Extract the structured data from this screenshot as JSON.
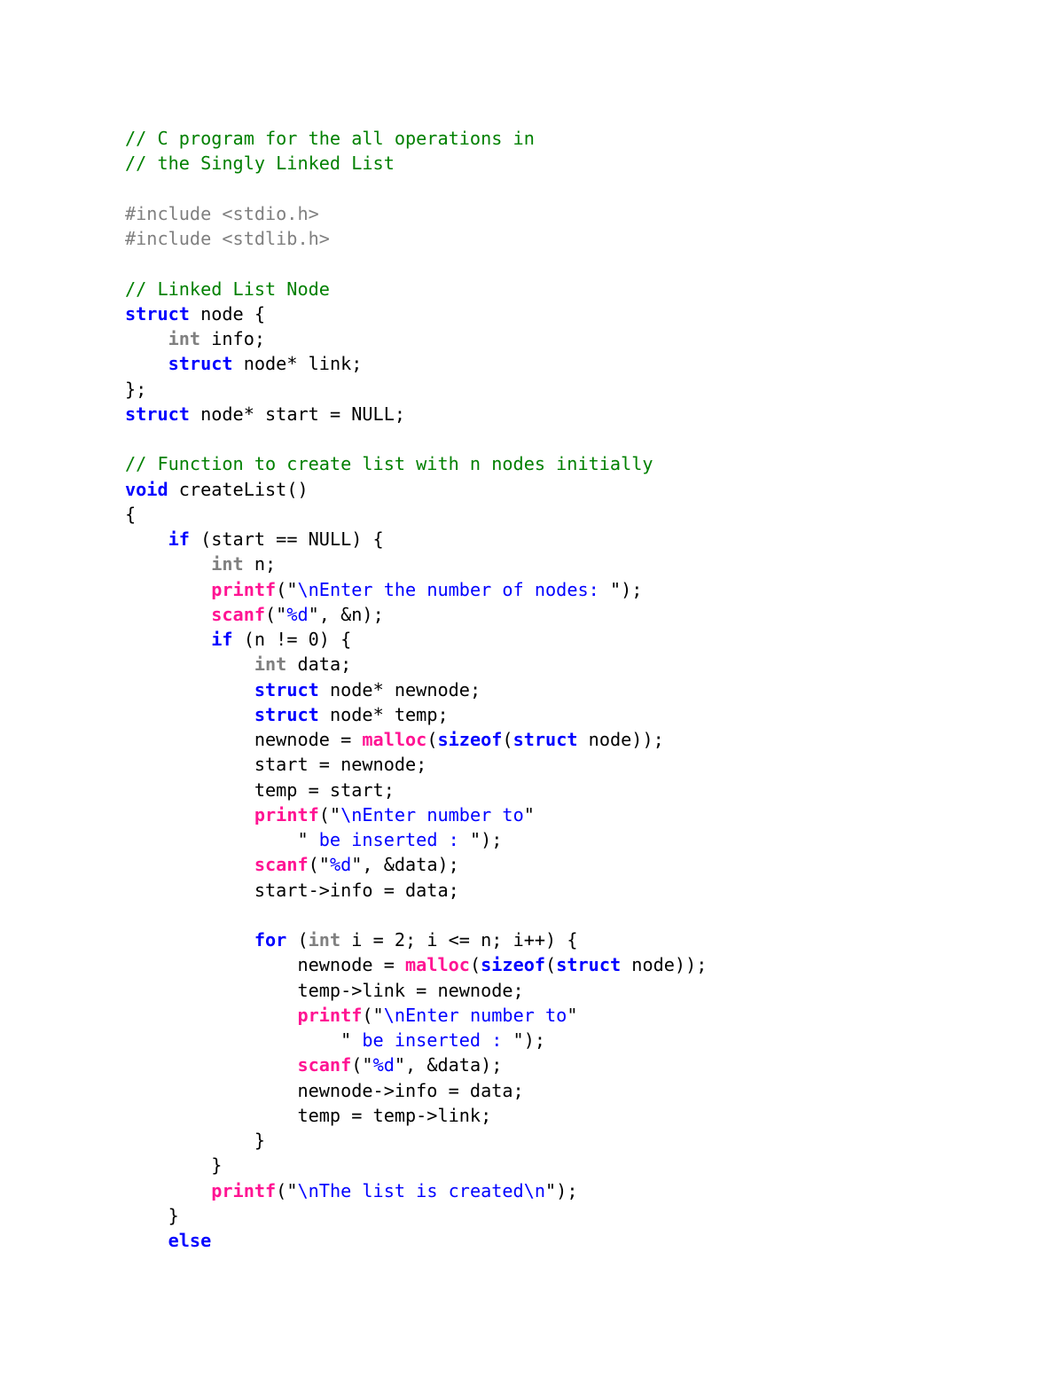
{
  "colors": {
    "comment": "#008000",
    "preprocessor": "#808080",
    "keyword": "#0000ff",
    "type_keyword": "#808080",
    "library_function": "#ff1493",
    "string": "#0000ff",
    "plain": "#000000",
    "background": "#ffffff"
  },
  "code": {
    "lines": [
      [
        {
          "t": "// C program for the all operations in",
          "k": "comment"
        }
      ],
      [
        {
          "t": "// the Singly Linked List",
          "k": "comment"
        }
      ],
      [],
      [
        {
          "t": "#include <stdio.h>",
          "k": "preproc"
        }
      ],
      [
        {
          "t": "#include <stdlib.h>",
          "k": "preproc"
        }
      ],
      [],
      [
        {
          "t": "// Linked List Node",
          "k": "comment"
        }
      ],
      [
        {
          "t": "struct",
          "k": "keyword"
        },
        {
          "t": " node {",
          "k": "plain"
        }
      ],
      [
        {
          "t": "    ",
          "k": "plain"
        },
        {
          "t": "int",
          "k": "type"
        },
        {
          "t": " info;",
          "k": "plain"
        }
      ],
      [
        {
          "t": "    ",
          "k": "plain"
        },
        {
          "t": "struct",
          "k": "keyword"
        },
        {
          "t": " node* link;",
          "k": "plain"
        }
      ],
      [
        {
          "t": "};",
          "k": "plain"
        }
      ],
      [
        {
          "t": "struct",
          "k": "keyword"
        },
        {
          "t": " node* start = NULL;",
          "k": "plain"
        }
      ],
      [],
      [
        {
          "t": "// Function to create list with n nodes initially",
          "k": "comment"
        }
      ],
      [
        {
          "t": "void",
          "k": "keyword"
        },
        {
          "t": " createList()",
          "k": "plain"
        }
      ],
      [
        {
          "t": "{",
          "k": "plain"
        }
      ],
      [
        {
          "t": "    ",
          "k": "plain"
        },
        {
          "t": "if",
          "k": "keyword"
        },
        {
          "t": " (start == NULL) {",
          "k": "plain"
        }
      ],
      [
        {
          "t": "        ",
          "k": "plain"
        },
        {
          "t": "int",
          "k": "type"
        },
        {
          "t": " n;",
          "k": "plain"
        }
      ],
      [
        {
          "t": "        ",
          "k": "plain"
        },
        {
          "t": "printf",
          "k": "func"
        },
        {
          "t": "(\"",
          "k": "plain"
        },
        {
          "t": "\\nEnter the number of nodes: ",
          "k": "string"
        },
        {
          "t": "\");",
          "k": "plain"
        }
      ],
      [
        {
          "t": "        ",
          "k": "plain"
        },
        {
          "t": "scanf",
          "k": "func"
        },
        {
          "t": "(\"",
          "k": "plain"
        },
        {
          "t": "%d",
          "k": "string"
        },
        {
          "t": "\", &n);",
          "k": "plain"
        }
      ],
      [
        {
          "t": "        ",
          "k": "plain"
        },
        {
          "t": "if",
          "k": "keyword"
        },
        {
          "t": " (n != 0) {",
          "k": "plain"
        }
      ],
      [
        {
          "t": "            ",
          "k": "plain"
        },
        {
          "t": "int",
          "k": "type"
        },
        {
          "t": " data;",
          "k": "plain"
        }
      ],
      [
        {
          "t": "            ",
          "k": "plain"
        },
        {
          "t": "struct",
          "k": "keyword"
        },
        {
          "t": " node* newnode;",
          "k": "plain"
        }
      ],
      [
        {
          "t": "            ",
          "k": "plain"
        },
        {
          "t": "struct",
          "k": "keyword"
        },
        {
          "t": " node* temp;",
          "k": "plain"
        }
      ],
      [
        {
          "t": "            newnode = ",
          "k": "plain"
        },
        {
          "t": "malloc",
          "k": "func"
        },
        {
          "t": "(",
          "k": "plain"
        },
        {
          "t": "sizeof",
          "k": "keyword"
        },
        {
          "t": "(",
          "k": "plain"
        },
        {
          "t": "struct",
          "k": "keyword"
        },
        {
          "t": " node));",
          "k": "plain"
        }
      ],
      [
        {
          "t": "            start = newnode;",
          "k": "plain"
        }
      ],
      [
        {
          "t": "            temp = start;",
          "k": "plain"
        }
      ],
      [
        {
          "t": "            ",
          "k": "plain"
        },
        {
          "t": "printf",
          "k": "func"
        },
        {
          "t": "(\"",
          "k": "plain"
        },
        {
          "t": "\\nEnter number to",
          "k": "string"
        },
        {
          "t": "\"",
          "k": "plain"
        }
      ],
      [
        {
          "t": "                \"",
          "k": "plain"
        },
        {
          "t": " be inserted : ",
          "k": "string"
        },
        {
          "t": "\");",
          "k": "plain"
        }
      ],
      [
        {
          "t": "            ",
          "k": "plain"
        },
        {
          "t": "scanf",
          "k": "func"
        },
        {
          "t": "(\"",
          "k": "plain"
        },
        {
          "t": "%d",
          "k": "string"
        },
        {
          "t": "\", &data);",
          "k": "plain"
        }
      ],
      [
        {
          "t": "            start->info = data;",
          "k": "plain"
        }
      ],
      [],
      [
        {
          "t": "            ",
          "k": "plain"
        },
        {
          "t": "for",
          "k": "keyword"
        },
        {
          "t": " (",
          "k": "plain"
        },
        {
          "t": "int",
          "k": "type"
        },
        {
          "t": " i = 2; i <= n; i++) {",
          "k": "plain"
        }
      ],
      [
        {
          "t": "                newnode = ",
          "k": "plain"
        },
        {
          "t": "malloc",
          "k": "func"
        },
        {
          "t": "(",
          "k": "plain"
        },
        {
          "t": "sizeof",
          "k": "keyword"
        },
        {
          "t": "(",
          "k": "plain"
        },
        {
          "t": "struct",
          "k": "keyword"
        },
        {
          "t": " node));",
          "k": "plain"
        }
      ],
      [
        {
          "t": "                temp->link = newnode;",
          "k": "plain"
        }
      ],
      [
        {
          "t": "                ",
          "k": "plain"
        },
        {
          "t": "printf",
          "k": "func"
        },
        {
          "t": "(\"",
          "k": "plain"
        },
        {
          "t": "\\nEnter number to",
          "k": "string"
        },
        {
          "t": "\"",
          "k": "plain"
        }
      ],
      [
        {
          "t": "                    \"",
          "k": "plain"
        },
        {
          "t": " be inserted : ",
          "k": "string"
        },
        {
          "t": "\");",
          "k": "plain"
        }
      ],
      [
        {
          "t": "                ",
          "k": "plain"
        },
        {
          "t": "scanf",
          "k": "func"
        },
        {
          "t": "(\"",
          "k": "plain"
        },
        {
          "t": "%d",
          "k": "string"
        },
        {
          "t": "\", &data);",
          "k": "plain"
        }
      ],
      [
        {
          "t": "                newnode->info = data;",
          "k": "plain"
        }
      ],
      [
        {
          "t": "                temp = temp->link;",
          "k": "plain"
        }
      ],
      [
        {
          "t": "            }",
          "k": "plain"
        }
      ],
      [
        {
          "t": "        }",
          "k": "plain"
        }
      ],
      [
        {
          "t": "        ",
          "k": "plain"
        },
        {
          "t": "printf",
          "k": "func"
        },
        {
          "t": "(\"",
          "k": "plain"
        },
        {
          "t": "\\nThe list is created\\n",
          "k": "string"
        },
        {
          "t": "\");",
          "k": "plain"
        }
      ],
      [
        {
          "t": "    }",
          "k": "plain"
        }
      ],
      [
        {
          "t": "    ",
          "k": "plain"
        },
        {
          "t": "else",
          "k": "keyword"
        }
      ]
    ]
  }
}
